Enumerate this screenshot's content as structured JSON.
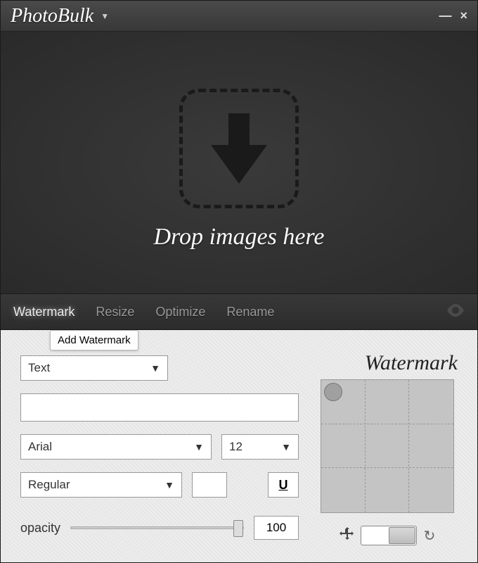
{
  "titlebar": {
    "app_name": "PhotoBulk"
  },
  "drop": {
    "caption": "Drop images here"
  },
  "tabs": {
    "items": [
      "Watermark",
      "Resize",
      "Optimize",
      "Rename"
    ],
    "active_index": 0
  },
  "tooltip": {
    "text": "Add Watermark"
  },
  "watermark": {
    "type_select": "Text",
    "text_value": "",
    "font_family": "Arial",
    "font_size": "12",
    "font_weight": "Regular",
    "underline_label": "U",
    "opacity_label": "opacity",
    "opacity_value": "100",
    "panel_title": "Watermark"
  }
}
